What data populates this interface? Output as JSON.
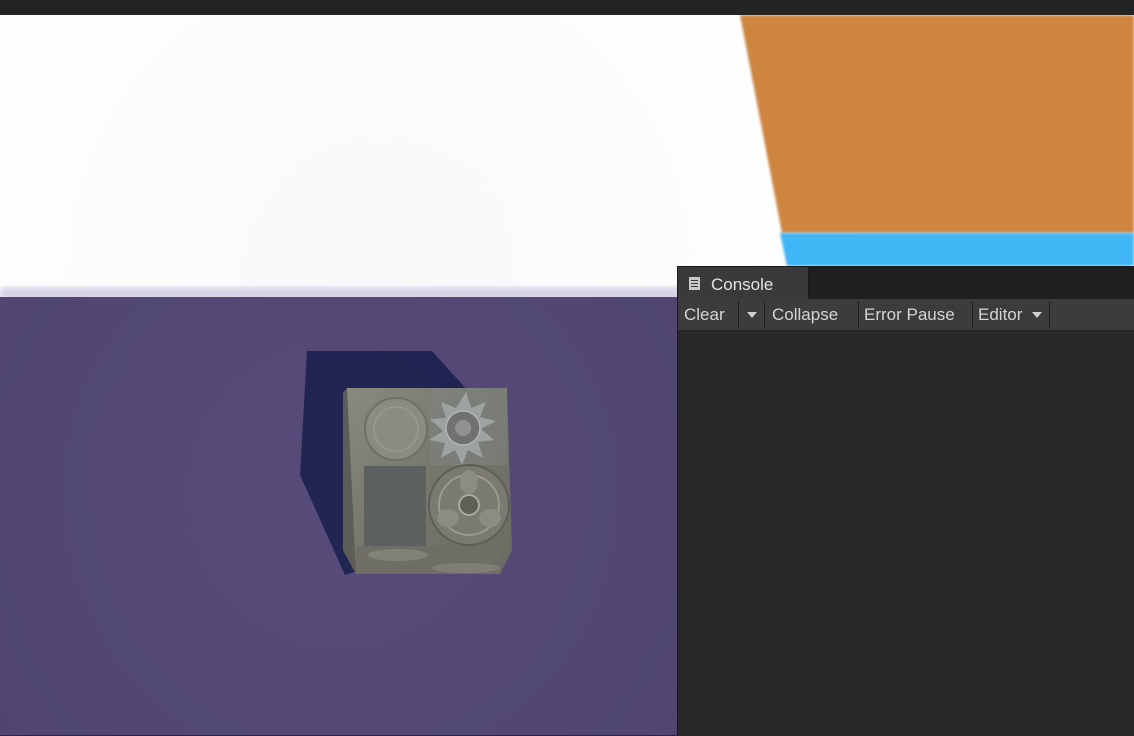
{
  "scene": {
    "colors": {
      "sky": "#fbfcfd",
      "ground": "#534874",
      "orange_wall": "#cd853f",
      "blue_strip": "#40b6f5",
      "shadow": "#1f2350",
      "cube_stone": "#7b7a70"
    }
  },
  "console": {
    "tab_icon": "console-icon",
    "tab_label": "Console",
    "toolbar": {
      "clear_label": "Clear",
      "clear_dropdown_icon": "chevron-down-icon",
      "collapse_label": "Collapse",
      "error_pause_label": "Error Pause",
      "editor_label": "Editor",
      "editor_dropdown_icon": "chevron-down-icon"
    },
    "colors": {
      "background": "#282828",
      "toolbar": "#3c3c3c",
      "text": "#d4d4d4"
    }
  }
}
